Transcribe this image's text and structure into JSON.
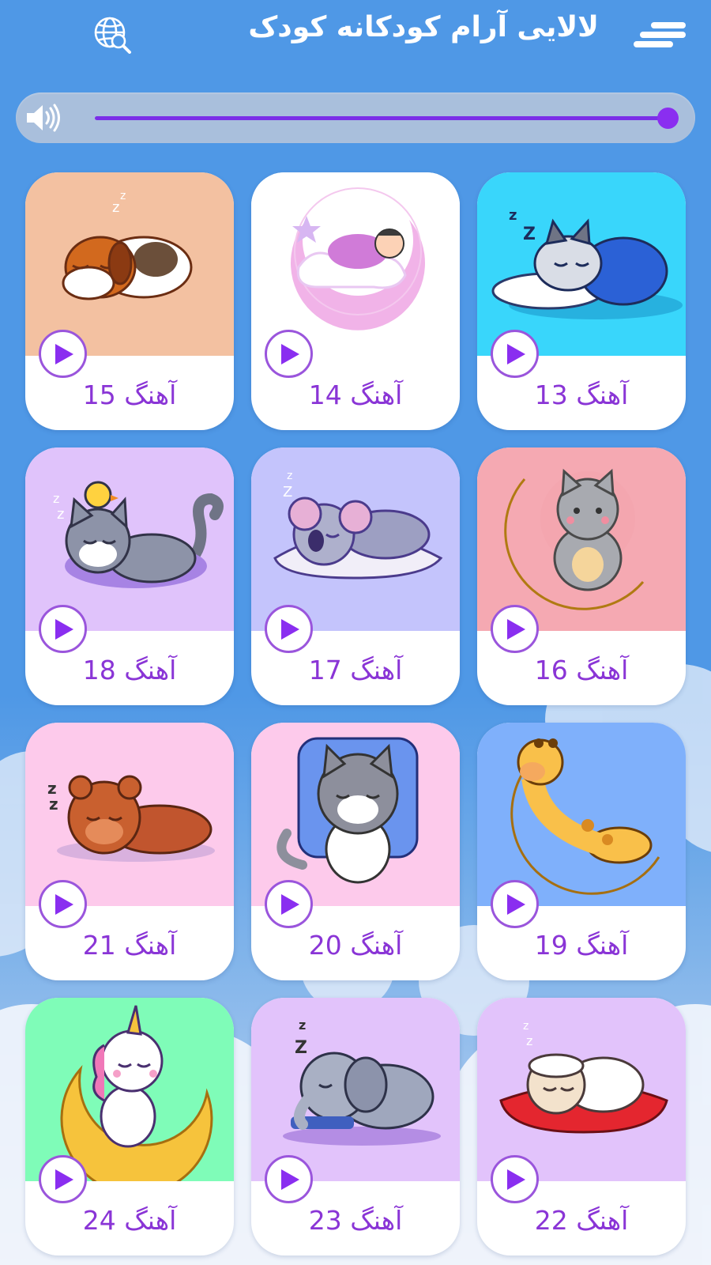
{
  "header": {
    "title": "لالایی آرام کودکانه کودک",
    "menu_icon": "menu-icon",
    "language_icon": "globe-search-icon"
  },
  "volume": {
    "icon": "speaker-icon",
    "level": 1.0
  },
  "colors": {
    "accent": "#8a2ef0",
    "label": "#8a35d6",
    "background": "#4f98e6"
  },
  "songs": [
    {
      "label": "آهنگ 15",
      "art": "sleeping-puppy",
      "bg": "#f3c1a1"
    },
    {
      "label": "آهنگ 14",
      "art": "baby-on-moon",
      "bg": "#ffffff"
    },
    {
      "label": "آهنگ 13",
      "art": "sleeping-raccoon-cat",
      "bg": "#39d6fb"
    },
    {
      "label": "آهنگ 18",
      "art": "cat-with-chick",
      "bg": "#e0c3fb"
    },
    {
      "label": "آهنگ 17",
      "art": "sleeping-koala",
      "bg": "#c4c4fc"
    },
    {
      "label": "آهنگ 16",
      "art": "cat-on-moon",
      "bg": "#f5a9b2"
    },
    {
      "label": "آهنگ 21",
      "art": "sleeping-bear",
      "bg": "#fdcaeb"
    },
    {
      "label": "آهنگ 20",
      "art": "cat-on-pillow",
      "bg": "#fdcaeb"
    },
    {
      "label": "آهنگ 19",
      "art": "giraffe-on-moon",
      "bg": "#7fb0fb"
    },
    {
      "label": "آهنگ 24",
      "art": "unicorn-on-moon",
      "bg": "#7ffcb8"
    },
    {
      "label": "آهنگ 23",
      "art": "sleeping-elephant",
      "bg": "#e2c3fb"
    },
    {
      "label": "آهنگ 22",
      "art": "sleeping-sheep",
      "bg": "#e2c3fb"
    }
  ]
}
